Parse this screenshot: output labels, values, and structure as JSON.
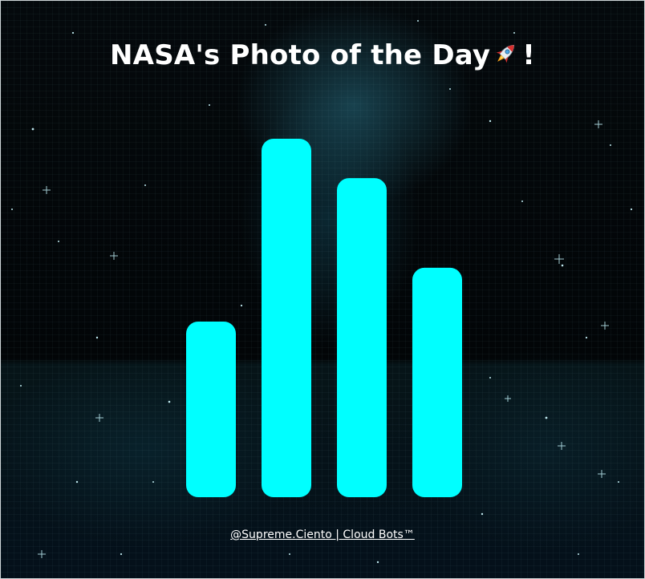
{
  "header": {
    "title_text": "NASA's Photo of the Day",
    "title_suffix": "!",
    "icon": "rocket-icon"
  },
  "footer": {
    "credit": "@Supreme.Ciento | Cloud Bots™"
  },
  "colors": {
    "bar": "#00ffff",
    "background": "#020507",
    "text": "#ffffff"
  },
  "chart_data": {
    "type": "bar",
    "categories": [
      "",
      "",
      "",
      ""
    ],
    "values": [
      49,
      100,
      89,
      64
    ],
    "title": "",
    "xlabel": "",
    "ylabel": "",
    "ylim": [
      0,
      100
    ],
    "grid": false
  }
}
